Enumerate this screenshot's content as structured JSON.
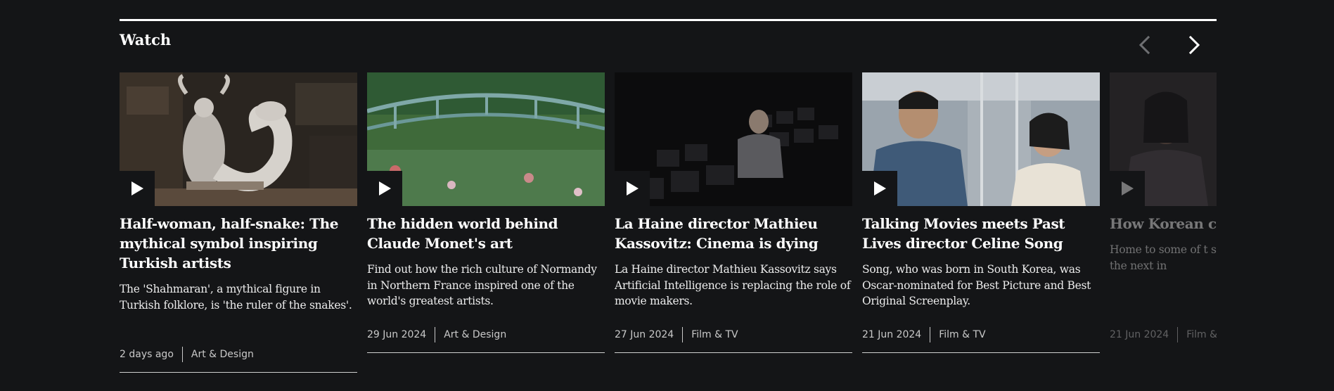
{
  "section": {
    "title": "Watch",
    "prev_icon": "chevron-left-icon",
    "next_icon": "chevron-right-icon"
  },
  "cards": [
    {
      "title": "Half-woman, half-snake: The mythical symbol inspiring Turkish artists",
      "description": "The 'Shahmaran', a mythical figure in Turkish folklore, is 'the ruler of the snakes'.",
      "date": "2 days ago",
      "category": "Art & Design",
      "play_icon": "play-icon"
    },
    {
      "title": "The hidden world behind Claude Monet's art",
      "description": "Find out how the rich culture of Normandy in Northern France inspired one of the world's greatest artists.",
      "date": "29 Jun 2024",
      "category": "Art & Design",
      "play_icon": "play-icon"
    },
    {
      "title": "La Haine director Mathieu Kassovitz: Cinema is dying",
      "description": "La Haine director Mathieu Kassovitz says Artificial Intelligence is replacing the role of movie makers.",
      "date": "27 Jun 2024",
      "category": "Film & TV",
      "play_icon": "play-icon"
    },
    {
      "title": "Talking Movies meets Past Lives director Celine Song",
      "description": "Song, who was born in South Korea, was Oscar-nominated for Best Picture and Best Original Screenplay.",
      "date": "21 Jun 2024",
      "category": "Film & TV",
      "play_icon": "play-icon"
    },
    {
      "title": "How Korean c capture new au",
      "description": "Home to some of t storytelling in the taking the next in",
      "date": "21 Jun 2024",
      "category": "Film &",
      "play_icon": "play-icon"
    }
  ]
}
